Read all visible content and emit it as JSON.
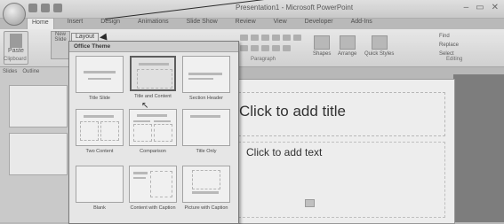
{
  "app": {
    "title": "Presentation1 - Microsoft PowerPoint",
    "window_controls": [
      "–",
      "▭",
      "✕"
    ]
  },
  "tabs": [
    "Home",
    "Insert",
    "Design",
    "Animations",
    "Slide Show",
    "Review",
    "View",
    "Developer",
    "Add-Ins"
  ],
  "ribbon": {
    "paste_label": "Paste",
    "new_slide_label": "New Slide",
    "layout_button": "Layout",
    "clipboard_group": "Clipboard",
    "paragraph_group": "Paragraph",
    "shapes_label": "Shapes",
    "arrange_label": "Arrange",
    "quick_styles_label": "Quick Styles",
    "find_label": "Find",
    "replace_label": "Replace",
    "select_label": "Select",
    "editing_group": "Editing"
  },
  "left_pane": {
    "tabs": [
      "Slides",
      "Outline"
    ]
  },
  "layout_gallery": {
    "header": "Office Theme",
    "items": [
      {
        "name": "Title Slide"
      },
      {
        "name": "Title and Content"
      },
      {
        "name": "Section Header"
      },
      {
        "name": "Two Content"
      },
      {
        "name": "Comparison"
      },
      {
        "name": "Title Only"
      },
      {
        "name": "Blank"
      },
      {
        "name": "Content with Caption"
      },
      {
        "name": "Picture with Caption"
      }
    ],
    "selected": 1
  },
  "slide": {
    "title_placeholder": "Click to add title",
    "body_placeholder": "Click to add text"
  }
}
